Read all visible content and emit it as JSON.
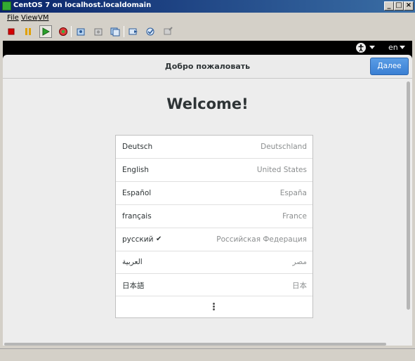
{
  "window": {
    "title": "CentOS 7 on localhost.localdomain",
    "minimize": "_",
    "restore": "□",
    "close": "×"
  },
  "menu": {
    "file": "File",
    "view": "View",
    "vm": "VM"
  },
  "toolbar": {
    "icons": [
      "stop-icon",
      "pause-icon",
      "play-icon",
      "refresh-icon",
      "settings-icon",
      "snapshot-icon",
      "snapshot-manager-icon",
      "send-keys-icon",
      "check-icon",
      "tools-icon"
    ]
  },
  "gnome": {
    "language_indicator": "en",
    "accessibility_icon": "accessibility-icon"
  },
  "header": {
    "title": "Добро пожаловать",
    "next_button": "Далее"
  },
  "main": {
    "welcome": "Welcome!",
    "languages": [
      {
        "native": "Deutsch",
        "region": "Deutschland",
        "selected": false
      },
      {
        "native": "English",
        "region": "United States",
        "selected": false
      },
      {
        "native": "Español",
        "region": "España",
        "selected": false
      },
      {
        "native": "français",
        "region": "France",
        "selected": false
      },
      {
        "native": "русский",
        "region": "Российская Федерация",
        "selected": true
      },
      {
        "native": "العربية",
        "region": "مصر",
        "selected": false
      },
      {
        "native": "日本語",
        "region": "日本",
        "selected": false
      }
    ],
    "check_mark": "✔"
  },
  "colors": {
    "accent": "#3a7fd3",
    "titlebar": "#0a246a"
  }
}
